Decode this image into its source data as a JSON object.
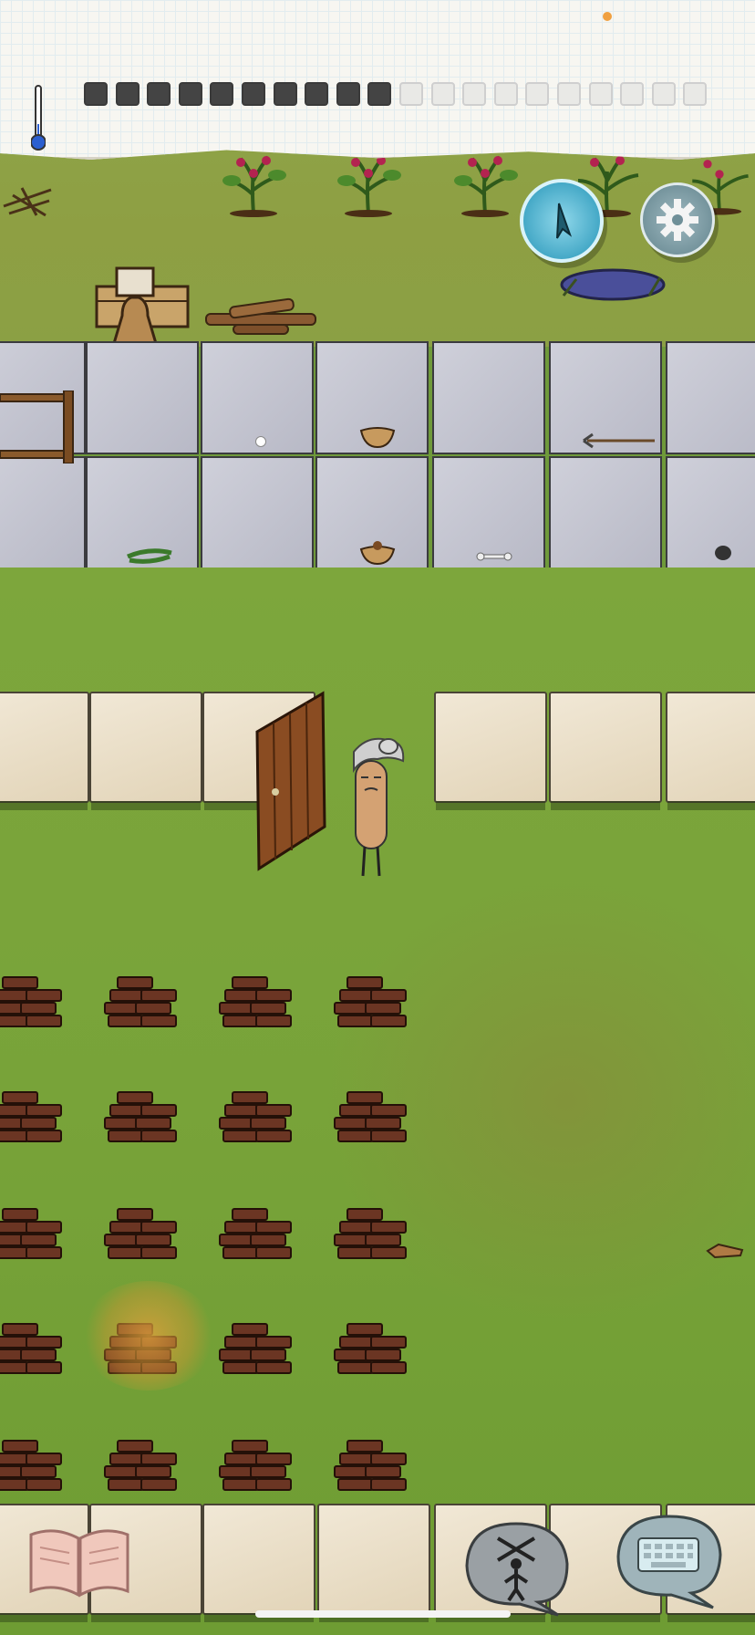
{
  "game": {
    "title": "",
    "player": {
      "name": "",
      "age_label": ""
    },
    "hud": {
      "compass_icon": "compass-icon",
      "settings_icon": "gear-icon",
      "temperature": {
        "level": 0.2,
        "color": "#2b5fd0"
      },
      "food": {
        "filled": 10,
        "total": 20
      },
      "status_dot_color": "#f0a040"
    },
    "bottom": {
      "book_icon": "open-book-icon",
      "emote_icon": "puppet-emote-icon",
      "keyboard_icon": "keyboard-icon"
    }
  }
}
